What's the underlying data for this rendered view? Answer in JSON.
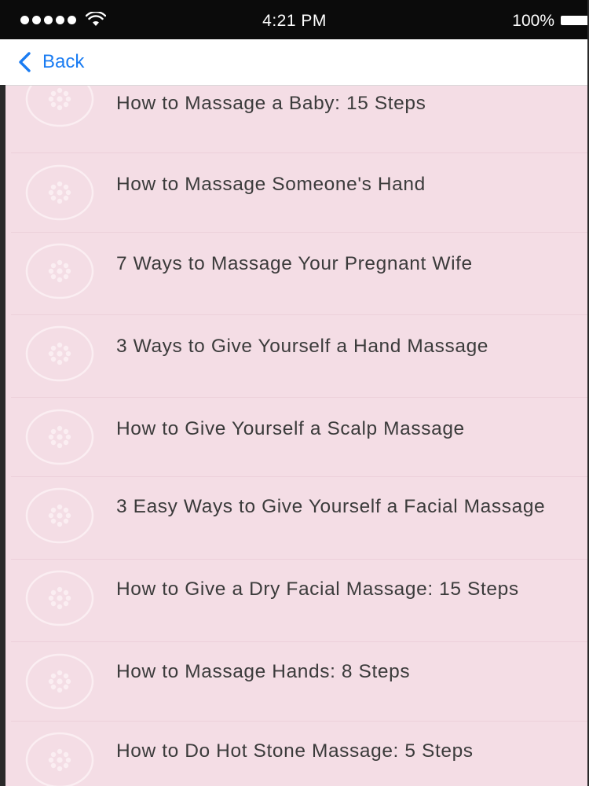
{
  "status_bar": {
    "time": "4:21 PM",
    "battery": "100%",
    "signal_dots": 5,
    "icons": [
      "signal-dots-icon",
      "wifi-icon",
      "battery-icon"
    ]
  },
  "nav": {
    "back_label": "Back",
    "back_icon": "chevron-left-icon",
    "accent_color": "#1a7cf2"
  },
  "colors": {
    "list_background": "#f4dde5",
    "title_text": "#3b3b3b",
    "status_bar": "#0b0b0b"
  },
  "articles": [
    {
      "title": "How to Massage a Baby: 15 Steps",
      "icon": "placeholder-image-icon"
    },
    {
      "title": "How to Massage Someone's Hand",
      "icon": "placeholder-image-icon"
    },
    {
      "title": "7 Ways to Massage Your Pregnant Wife",
      "icon": "placeholder-image-icon"
    },
    {
      "title": "3 Ways to Give Yourself a Hand Massage",
      "icon": "placeholder-image-icon"
    },
    {
      "title": "How to Give Yourself a Scalp Massage",
      "icon": "placeholder-image-icon"
    },
    {
      "title": "3 Easy Ways to Give Yourself a Facial Massage",
      "icon": "placeholder-image-icon"
    },
    {
      "title": "How to Give a Dry Facial Massage: 15 Steps",
      "icon": "placeholder-image-icon"
    },
    {
      "title": "How to Massage Hands: 8 Steps",
      "icon": "placeholder-image-icon"
    },
    {
      "title": "How to Do Hot Stone Massage: 5 Steps",
      "icon": "placeholder-image-icon"
    }
  ]
}
